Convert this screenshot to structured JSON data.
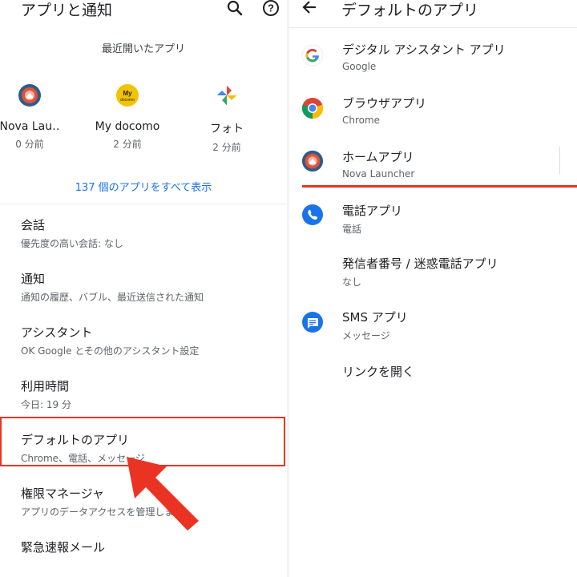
{
  "left": {
    "title": "アプリと通知",
    "recent_header": "最近開いたアプリ",
    "recent_apps": [
      {
        "name": "Nova Lau‥",
        "time": "0 分前",
        "icon": "nova-launcher-icon"
      },
      {
        "name": "My docomo",
        "time": "2 分前",
        "icon": "my-docomo-icon",
        "badge_line1": "My",
        "badge_line2": "docomo"
      },
      {
        "name": "フォト",
        "time": "2 分前",
        "icon": "google-photos-icon"
      }
    ],
    "see_all": "137 個のアプリをすべて表示",
    "items": [
      {
        "title": "会話",
        "subtitle": "優先度の高い会話: なし"
      },
      {
        "title": "通知",
        "subtitle": "通知の履歴、バブル、最近送信された通知"
      },
      {
        "title": "アシスタント",
        "subtitle": "OK Google とその他のアシスタント設定"
      },
      {
        "title": "利用時間",
        "subtitle": "今日: 19 分"
      },
      {
        "title": "デフォルトのアプリ",
        "subtitle": "Chrome、電話、メッセージ"
      },
      {
        "title": "権限マネージャ",
        "subtitle": "アプリのデータアクセスを管理します"
      },
      {
        "title": "緊急速報メール",
        "subtitle": ""
      }
    ]
  },
  "right": {
    "title": "デフォルトのアプリ",
    "items": [
      {
        "title": "デジタル アシスタント アプリ",
        "subtitle": "Google",
        "icon": "google-icon"
      },
      {
        "title": "ブラウザアプリ",
        "subtitle": "Chrome",
        "icon": "chrome-icon"
      },
      {
        "title": "ホームアプリ",
        "subtitle": "Nova Launcher",
        "icon": "nova-launcher-icon"
      },
      {
        "title": "電話アプリ",
        "subtitle": "電話",
        "icon": "phone-icon"
      },
      {
        "title": "発信者番号 / 迷惑電話アプリ",
        "subtitle": "なし",
        "icon": ""
      },
      {
        "title": "SMS アプリ",
        "subtitle": "メッセージ",
        "icon": "messages-icon"
      },
      {
        "title": "リンクを開く",
        "subtitle": "",
        "icon": ""
      }
    ]
  },
  "colors": {
    "accent_link": "#1a73e8",
    "highlight_red": "#ea3323"
  }
}
